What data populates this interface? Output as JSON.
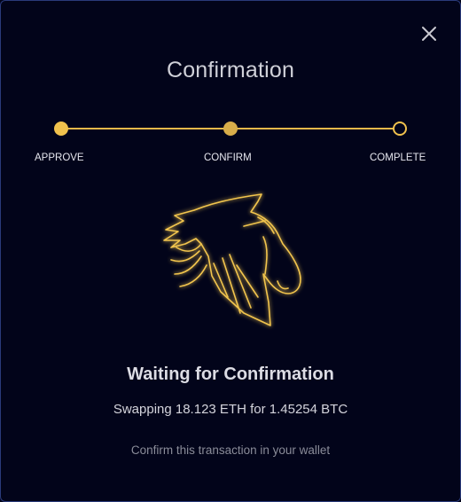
{
  "dialog": {
    "title": "Confirmation",
    "close_icon": "close-icon"
  },
  "stepper": {
    "steps": [
      {
        "label": "APPROVE",
        "state": "done"
      },
      {
        "label": "CONFIRM",
        "state": "current"
      },
      {
        "label": "COMPLETE",
        "state": "pending"
      }
    ],
    "accent_color": "#f1c24d"
  },
  "logo": {
    "icon": "horse-head-logo"
  },
  "status": {
    "heading": "Waiting for Confirmation",
    "swap_text": "Swapping 18.123 ETH for 1.45254 BTC",
    "hint": "Confirm this transaction in your wallet"
  },
  "colors": {
    "background": "#02041a",
    "border": "#2a3a7a"
  }
}
